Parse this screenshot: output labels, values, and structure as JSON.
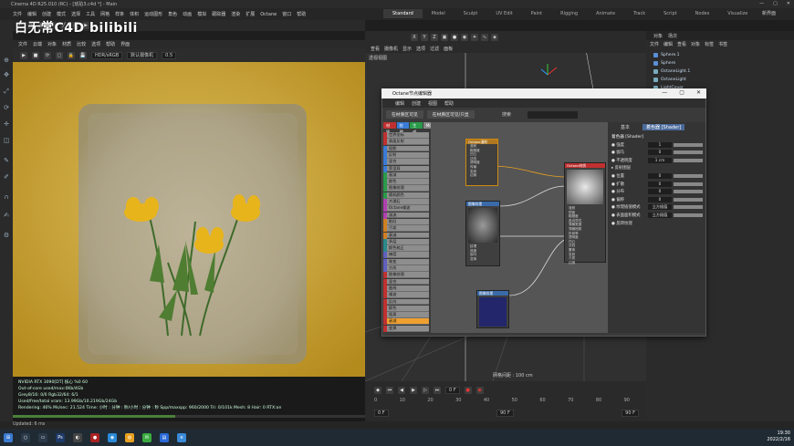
{
  "window": {
    "title": "Cinema 4D R25.010 (RC) - [琥珀3.c4d *] - Main",
    "min": "—",
    "max": "▢",
    "close": "✕"
  },
  "menubar": {
    "items": [
      "文件",
      "编辑",
      "创建",
      "模式",
      "选择",
      "工具",
      "网格",
      "样条",
      "体积",
      "运动图形",
      "角色",
      "动画",
      "模拟",
      "跟踪器",
      "渲染",
      "扩展",
      "Octane",
      "窗口",
      "帮助"
    ]
  },
  "layouts": {
    "items": [
      "Standard",
      "Model",
      "Sculpt",
      "UV Edit",
      "Paint",
      "Rigging",
      "Animate",
      "Track",
      "Script",
      "Nodes",
      "Visualize"
    ],
    "active": "Standard",
    "new_layout": "新界面"
  },
  "watermark": {
    "text": "白无常C4D bilibili"
  },
  "render_window": {
    "menu": [
      "文件",
      "云端",
      "对象",
      "材质",
      "比较",
      "选项",
      "帮助",
      "界面"
    ],
    "color_mode": "HDR/sRGB",
    "camera_label": "默认摄像机",
    "zoom": "0.5",
    "status_lines": [
      "NVIDIA RTX 3090[DT] 核心   %0    60",
      "Out-of-core used/max:0Kb/4Gb",
      "Grey8/16: 0/0          Rgb32/64: 6/1",
      "Used/free/total vram: 13.99Gb/10.219Gb/24Gb",
      "Rendering: 46%  Ms/sec: 21.524  Time: 小时 : 分钟 : 秒/小时 : 分钟 : 秒   Spp/maxspp: 960/2000   Tri: 0/101k   Mesh: 8   Hair: 0   RTX:on"
    ],
    "progress": 0.46,
    "status_bar": "Updated: 6 ms"
  },
  "viewport": {
    "menu": [
      "查看",
      "摄像机",
      "显示",
      "选项",
      "过滤",
      "面板"
    ],
    "label": "透视视图",
    "grid_spacing": "网格间距 : 100 cm",
    "axis_x": "X",
    "axis_y": "Y",
    "axis_z": "Z"
  },
  "timeline": {
    "ticks": [
      "0",
      "10",
      "20",
      "30",
      "40",
      "50",
      "60",
      "70",
      "80",
      "90"
    ],
    "frame_current": "0 F",
    "frame_start": "0 F",
    "frame_end": "90 F",
    "frame_end2": "90 F"
  },
  "object_manager": {
    "tabs": [
      "对象",
      "场次"
    ],
    "menu": [
      "文件",
      "编辑",
      "查看",
      "对象",
      "标签",
      "书签"
    ],
    "objects": [
      {
        "name": "Sphere.1",
        "color": "#5a8fd8"
      },
      {
        "name": "Sphere",
        "color": "#5a8fd8"
      },
      {
        "name": "OctaneLight.1",
        "color": "#7ab"
      },
      {
        "name": "OctaneLight",
        "color": "#7ab"
      },
      {
        "name": "LightCover",
        "color": "#7ab"
      }
    ]
  },
  "octane_editor": {
    "title": "Octane节点编辑器",
    "menu": [
      "编辑",
      "创建",
      "视图",
      "帮助"
    ],
    "tabs": [
      "在材质区可见",
      "在材质区可见/只显"
    ],
    "search_label": "搜索",
    "filter_chips": [
      {
        "label": "材质",
        "color": "#c03030"
      },
      {
        "label": "纹理",
        "color": "#3a7bd5"
      },
      {
        "label": "生成",
        "color": "#2a9a4a"
      },
      {
        "label": "Mo",
        "color": "#888"
      },
      {
        "label": "几何",
        "color": "#b040b0"
      },
      {
        "label": "发射",
        "color": "#d08020"
      },
      {
        "label": "变换",
        "color": "#2a8a8a"
      },
      {
        "label": "介质",
        "color": "#6060c0"
      },
      {
        "label": "C4D",
        "color": "#222"
      }
    ],
    "node_list": [
      "世界坐标",
      "表面反射",
      "投影",
      "反射",
      "混合",
      "菲涅耳",
      "衰减",
      "颜色",
      "图像纹理",
      "随机颜色",
      "大理石",
      "Octane噪波",
      "湍流",
      "脏旧",
      "污垢",
      "衰减",
      "多层",
      "颜色校正",
      "梯度",
      "渐变",
      "方形",
      "图像纹理",
      "混合",
      "曲线",
      "噪波",
      "反向",
      "颜色",
      "距离",
      "衰减",
      "变换"
    ],
    "selected_index": 28,
    "nodes": {
      "a": {
        "title": "Octane漫射",
        "rows": [
          "漫射",
          "粗糙度",
          "凹凸",
          "法线",
          "透明度",
          "传输",
          "发射",
          "边缘"
        ]
      },
      "b": {
        "title": "图像纹理",
        "rows": [
          "纹理",
          "强度",
          "伽马",
          "变换",
          "投影",
          "边框"
        ]
      },
      "c": {
        "title": "Octane材质",
        "rows": [
          "漫射",
          "镜面",
          "粗糙度",
          "各向异性",
          "薄膜宽度",
          "薄膜指数",
          "折射率",
          "透明度",
          "凹凸",
          "法线",
          "置换",
          "发射",
          "介质",
          "边缘"
        ]
      },
      "d": {
        "title": "图像纹理",
        "rows": []
      }
    },
    "attr_tabs": [
      "基本",
      "着色器 [Shader]"
    ],
    "attr_section": "着色器 [Shader]",
    "attr_rows": [
      {
        "label": "● 强度",
        "val": "1"
      },
      {
        "label": "● 伽马",
        "val": "0"
      },
      {
        "label": "● 不透明度",
        "val": "1 cm"
      },
      {
        "label": "▸ 反射图层",
        "val": ""
      },
      {
        "label": "● 位置",
        "val": "0"
      },
      {
        "label": "● 扩散",
        "val": "0"
      },
      {
        "label": "● 分布",
        "val": "0"
      },
      {
        "label": "● 偏移",
        "val": "0"
      },
      {
        "label": "● 纹理插值模式",
        "val": "立方插值"
      },
      {
        "label": "● 表面面积模式",
        "val": "立方插值"
      },
      {
        "label": "● 反转纹理",
        "val": ""
      }
    ]
  },
  "taskbar": {
    "time": "19:30",
    "date": "2022/2/16"
  }
}
